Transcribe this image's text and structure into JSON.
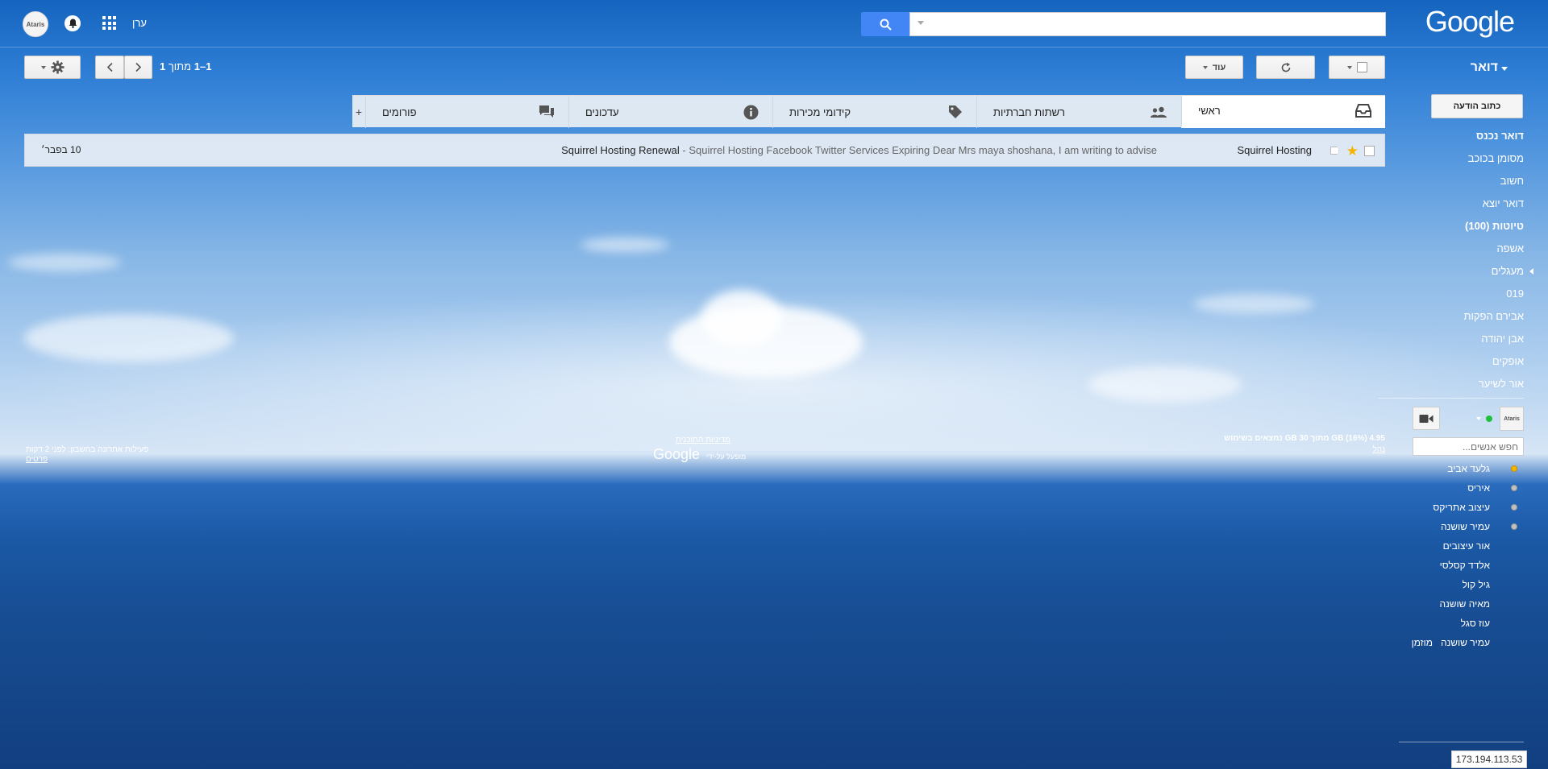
{
  "header": {
    "logo": "Google",
    "search_value": "",
    "user_name": "ערן",
    "avatar_text": "Ataris"
  },
  "toolbar": {
    "mail_label": "דואר",
    "more_label": "עוד",
    "pager_range": "1–1",
    "pager_of": "מתוך",
    "pager_total": "1"
  },
  "sidebar": {
    "compose_label": "כתוב הודעה",
    "items": [
      {
        "label": "דואר נכנס",
        "bold": true
      },
      {
        "label": "מסומן בכוכב",
        "bold": false
      },
      {
        "label": "חשוב",
        "bold": false
      },
      {
        "label": "דואר יוצא",
        "bold": false
      },
      {
        "label": "טיוטות (100)",
        "bold": true
      },
      {
        "label": "אשפה",
        "bold": false
      },
      {
        "label": "מעגלים",
        "bold": false
      },
      {
        "label": "019",
        "bold": false
      },
      {
        "label": "אבירם הפקות",
        "bold": false
      },
      {
        "label": "אבן יהודה",
        "bold": false
      },
      {
        "label": "אופקים",
        "bold": false
      },
      {
        "label": "אור לשיער",
        "bold": false
      }
    ]
  },
  "chat": {
    "avatar_text": "Ataris",
    "search_placeholder": "חפש אנשים...",
    "contacts": [
      {
        "name": "גלעד אביב",
        "status": "idle"
      },
      {
        "name": "איריס",
        "status": "offline"
      },
      {
        "name": "עיצוב אתריקס",
        "status": "offline"
      },
      {
        "name": "עמיר שושנה",
        "status": "offline"
      },
      {
        "name": "אור עיצובים",
        "status": "none"
      },
      {
        "name": "אלדד קסלסי",
        "status": "none"
      },
      {
        "name": "גיל קול",
        "status": "none"
      },
      {
        "name": "מאיה שושנה",
        "status": "none"
      },
      {
        "name": "עוז סגל",
        "status": "none"
      },
      {
        "name": "עמיר שושנה",
        "status": "none",
        "suffix": "מוזמן"
      }
    ]
  },
  "tabs": [
    {
      "label": "ראשי",
      "icon": "inbox-icon",
      "active": true
    },
    {
      "label": "רשתות חברתיות",
      "icon": "people-icon",
      "active": false
    },
    {
      "label": "קידומי מכירות",
      "icon": "tag-icon",
      "active": false
    },
    {
      "label": "עדכונים",
      "icon": "info-icon",
      "active": false
    },
    {
      "label": "פורומים",
      "icon": "forum-icon",
      "active": false
    }
  ],
  "messages": [
    {
      "sender": "Squirrel Hosting",
      "subject": "Squirrel Hosting Renewal",
      "snippet": "Squirrel Hosting Facebook Twitter Services Expiring Dear Mrs maya shoshana, I am writing to advise",
      "date": "10 בפבר׳"
    }
  ],
  "footer": {
    "storage_text": "4.95 GB (16%) מתוך 30 GB נמצאים בשימוש",
    "manage_link": "נהל",
    "terms_link": "מדיניות התוכנית",
    "powered_by": "מופעל על-ידי",
    "google_logo": "Google",
    "last_activity": "פעילות אחרונה בחשבון: לפני 2 דקות",
    "details_link": "פרטים"
  },
  "ip_address": "173.194.113.53",
  "colors": {
    "accent_blue": "#4285f4",
    "star": "#f4b400",
    "online": "#1fc13a"
  }
}
